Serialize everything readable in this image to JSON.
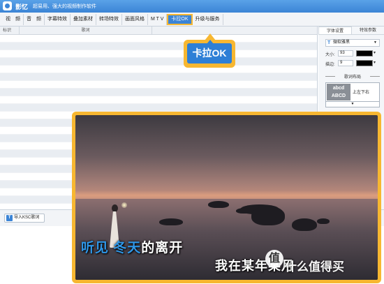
{
  "titlebar": {
    "app_name": "影忆",
    "slogan": "超易用、强大的视频制作软件"
  },
  "menu": {
    "items": [
      {
        "key": "video",
        "label": "视　频"
      },
      {
        "key": "audio",
        "label": "音　频"
      },
      {
        "key": "subtitle",
        "label": "字幕特效"
      },
      {
        "key": "overlay",
        "label": "叠加素材"
      },
      {
        "key": "transition",
        "label": "转场特效"
      },
      {
        "key": "style",
        "label": "画面风格"
      },
      {
        "key": "mtv",
        "label": "M T V"
      },
      {
        "key": "karaoke",
        "label": "卡拉OK",
        "active": true
      },
      {
        "key": "upgrade",
        "label": "升级与服务"
      }
    ]
  },
  "grid": {
    "col_mark": "标识",
    "col_lyric": "歌词"
  },
  "right_panel": {
    "tab_font": "字体设置",
    "tab_effect": "特效参数",
    "font_value": "微软雅黑",
    "size_label": "大小:",
    "size_value": "93",
    "stroke_label": "描边:",
    "stroke_value": "9",
    "layout_title": "歌词布局",
    "layout_preview_1": "abcd",
    "layout_preview_2": "ABCD",
    "layout_value": "上左下右"
  },
  "bottom": {
    "import_button": "导入KSC歌词",
    "import_icon_glyph": "T"
  },
  "callout": {
    "text": "卡拉OK"
  },
  "preview": {
    "lyric_line1_sung": "听见 冬天",
    "lyric_line1_rest": "的离开",
    "lyric_line2": "我在某年某月",
    "watermark_glyph": "值",
    "watermark_text": "什么值得买"
  },
  "colors": {
    "accent": "#3b84d6",
    "highlight": "#f7b731",
    "lyric_sung": "#2f97e8"
  }
}
